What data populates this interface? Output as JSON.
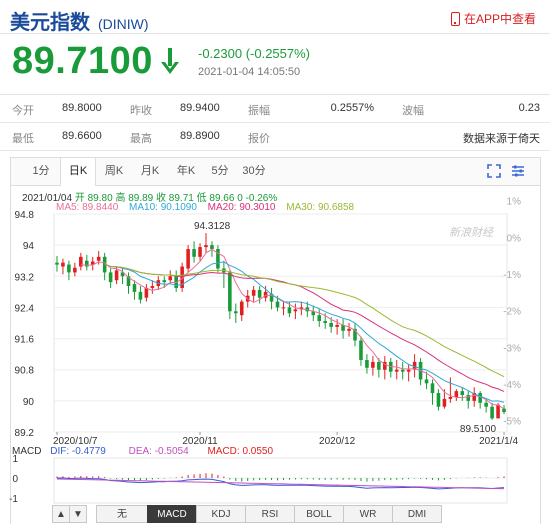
{
  "header": {
    "title": "美元指数",
    "code": "(DINIW)",
    "app_link": "在APP中查看"
  },
  "quote": {
    "price": "89.7100",
    "change": "-0.2300 (-0.2557%)",
    "time": "2021-01-04 14:05:50"
  },
  "stats": [
    {
      "l1": "今开",
      "v1": "89.8000",
      "l2": "昨收",
      "v2": "89.9400",
      "l3": "振幅",
      "v3": "0.2557%",
      "l4": "波幅",
      "v4": "0.23"
    },
    {
      "l1": "最低",
      "v1": "89.6600",
      "l2": "最高",
      "v2": "89.8900",
      "l3": "报价",
      "v3": "",
      "l4": "",
      "v4": "数据来源于倚天"
    }
  ],
  "tabs": [
    "1分",
    "日K",
    "周K",
    "月K",
    "年K",
    "5分",
    "30分"
  ],
  "info": {
    "date": "2021/01/04",
    "open": "开 89.80",
    "high": "高 89.89",
    "close": "收 89.71",
    "low": "低 89.66",
    "chg": "0 -0.26%"
  },
  "ma": {
    "ma5": "MA5: 89.8440",
    "ma10": "MA10: 90.1090",
    "ma20": "MA20: 90.3010",
    "ma30": "MA30: 90.6858"
  },
  "macd": {
    "label": "MACD",
    "dif": "DIF: -0.4779",
    "dea": "DEA: -0.5054",
    "macd": "MACD: 0.0550"
  },
  "buttons": [
    "▲",
    "▼",
    "无",
    "MACD",
    "KDJ",
    "RSI",
    "BOLL",
    "WR",
    "DMI"
  ],
  "colors": {
    "up": "#e02020",
    "down": "#1a9b3a",
    "ma5": "#e8709a",
    "ma10": "#2fa8d8",
    "ma20": "#d8307a",
    "ma30": "#9aba30",
    "dif": "#3a5ad8",
    "dea": "#c050c0",
    "title": "#1a4a9a"
  },
  "chart_data": {
    "type": "candlestick",
    "y_ticks": [
      "94.8",
      "94",
      "93.2",
      "92.4",
      "91.6",
      "90.8",
      "90",
      "89.2"
    ],
    "y_ticks_right": [
      "1%",
      "0%",
      "-1%",
      "-2%",
      "-3%",
      "-4%",
      "-5%"
    ],
    "x_ticks": [
      "2020/10/7",
      "2020/11",
      "2020/12",
      "2021/1/4"
    ],
    "ylim": [
      89.2,
      94.8
    ],
    "annot_max": "94.3128",
    "annot_min": "89.5100",
    "macd_ticks": [
      "1",
      "0",
      "-1"
    ],
    "watermark": "新浪财经",
    "candles": [
      [
        93.55,
        93.5,
        93.72,
        93.32
      ],
      [
        93.45,
        93.55,
        93.65,
        93.25
      ],
      [
        93.5,
        93.3,
        93.6,
        93.1
      ],
      [
        93.3,
        93.42,
        93.55,
        93.2
      ],
      [
        93.45,
        93.7,
        93.8,
        93.35
      ],
      [
        93.6,
        93.45,
        93.75,
        93.35
      ],
      [
        93.5,
        93.58,
        93.7,
        93.35
      ],
      [
        93.6,
        93.7,
        93.85,
        93.5
      ],
      [
        93.7,
        93.3,
        93.8,
        93.1
      ],
      [
        93.3,
        93.05,
        93.4,
        92.9
      ],
      [
        93.1,
        93.35,
        93.45,
        93.0
      ],
      [
        93.3,
        93.2,
        93.4,
        93.0
      ],
      [
        93.2,
        92.95,
        93.3,
        92.75
      ],
      [
        93.0,
        92.8,
        93.1,
        92.6
      ],
      [
        92.8,
        92.6,
        92.95,
        92.5
      ],
      [
        92.65,
        92.9,
        93.0,
        92.55
      ],
      [
        92.9,
        92.95,
        93.1,
        92.75
      ],
      [
        92.95,
        93.1,
        93.2,
        92.85
      ],
      [
        93.1,
        93.05,
        93.2,
        92.9
      ],
      [
        93.1,
        93.2,
        93.35,
        93.0
      ],
      [
        93.2,
        92.9,
        93.35,
        92.8
      ],
      [
        92.9,
        93.45,
        93.55,
        92.8
      ],
      [
        93.4,
        93.9,
        94.0,
        93.3
      ],
      [
        93.9,
        93.7,
        94.1,
        93.55
      ],
      [
        93.7,
        93.95,
        94.05,
        93.6
      ],
      [
        93.95,
        94.0,
        94.31,
        93.8
      ],
      [
        94.0,
        93.9,
        94.1,
        93.7
      ],
      [
        93.9,
        93.4,
        94.0,
        93.3
      ],
      [
        93.4,
        93.3,
        93.6,
        92.9
      ],
      [
        93.3,
        92.3,
        93.35,
        92.1
      ],
      [
        92.3,
        92.25,
        92.5,
        92.0
      ],
      [
        92.2,
        92.55,
        92.6,
        92.05
      ],
      [
        92.55,
        92.7,
        92.85,
        92.4
      ],
      [
        92.7,
        92.85,
        92.95,
        92.55
      ],
      [
        92.85,
        92.65,
        92.95,
        92.5
      ],
      [
        92.65,
        92.8,
        92.95,
        92.55
      ],
      [
        92.75,
        92.55,
        92.9,
        92.35
      ],
      [
        92.55,
        92.4,
        92.7,
        92.3
      ],
      [
        92.4,
        92.4,
        92.55,
        92.2
      ],
      [
        92.4,
        92.25,
        92.55,
        92.15
      ],
      [
        92.3,
        92.35,
        92.5,
        92.1
      ],
      [
        92.35,
        92.4,
        92.55,
        92.2
      ],
      [
        92.4,
        92.3,
        92.55,
        92.15
      ],
      [
        92.3,
        92.2,
        92.45,
        92.05
      ],
      [
        92.2,
        92.05,
        92.35,
        91.9
      ],
      [
        92.05,
        92.0,
        92.25,
        91.85
      ],
      [
        92.0,
        91.9,
        92.15,
        91.75
      ],
      [
        91.9,
        91.95,
        92.1,
        91.7
      ],
      [
        91.95,
        91.8,
        92.1,
        91.6
      ],
      [
        91.8,
        91.85,
        92.0,
        91.65
      ],
      [
        91.85,
        91.55,
        92.0,
        91.4
      ],
      [
        91.55,
        91.05,
        91.65,
        90.9
      ],
      [
        91.05,
        90.85,
        91.2,
        90.7
      ],
      [
        90.85,
        91.0,
        91.15,
        90.65
      ],
      [
        91.0,
        90.8,
        91.1,
        90.6
      ],
      [
        90.8,
        91.0,
        91.15,
        90.55
      ],
      [
        91.0,
        90.75,
        91.1,
        90.6
      ],
      [
        90.75,
        90.8,
        91.05,
        90.55
      ],
      [
        90.8,
        90.75,
        91.0,
        90.55
      ],
      [
        90.75,
        90.8,
        90.95,
        90.5
      ],
      [
        90.8,
        91.0,
        91.2,
        90.6
      ],
      [
        91.0,
        90.55,
        91.1,
        90.4
      ],
      [
        90.55,
        90.45,
        90.75,
        90.3
      ],
      [
        90.45,
        90.2,
        90.55,
        89.9
      ],
      [
        90.2,
        89.85,
        90.3,
        89.75
      ],
      [
        89.85,
        90.05,
        90.3,
        89.8
      ],
      [
        90.05,
        90.1,
        90.6,
        89.95
      ],
      [
        90.1,
        90.25,
        90.3,
        90.0
      ],
      [
        90.25,
        90.15,
        90.35,
        90.0
      ],
      [
        90.15,
        90.0,
        90.25,
        89.8
      ],
      [
        90.0,
        90.2,
        90.35,
        89.85
      ],
      [
        90.2,
        89.95,
        90.25,
        89.8
      ],
      [
        89.95,
        89.85,
        90.05,
        89.7
      ],
      [
        89.85,
        89.55,
        89.95,
        89.51
      ],
      [
        89.55,
        89.9,
        89.95,
        89.55
      ],
      [
        89.8,
        89.71,
        89.89,
        89.66
      ]
    ],
    "macd_hist": [
      0.05,
      0.06,
      0.04,
      0.05,
      0.07,
      0.06,
      0.05,
      0.06,
      0.03,
      -0.02,
      -0.03,
      -0.05,
      -0.07,
      -0.08,
      -0.09,
      -0.07,
      -0.05,
      -0.03,
      -0.02,
      0.01,
      0.02,
      0.05,
      0.1,
      0.12,
      0.14,
      0.16,
      0.15,
      0.1,
      0.05,
      -0.05,
      -0.1,
      -0.12,
      -0.1,
      -0.08,
      -0.07,
      -0.06,
      -0.07,
      -0.08,
      -0.07,
      -0.06,
      -0.05,
      -0.04,
      -0.04,
      -0.05,
      -0.06,
      -0.06,
      -0.06,
      -0.05,
      -0.06,
      -0.05,
      -0.07,
      -0.1,
      -0.12,
      -0.1,
      -0.09,
      -0.07,
      -0.07,
      -0.06,
      -0.05,
      -0.04,
      -0.02,
      -0.03,
      -0.04,
      -0.06,
      -0.08,
      -0.06,
      -0.03,
      -0.01,
      0.0,
      0.01,
      0.02,
      0.02,
      0.01,
      0.0,
      0.03,
      0.055
    ]
  }
}
